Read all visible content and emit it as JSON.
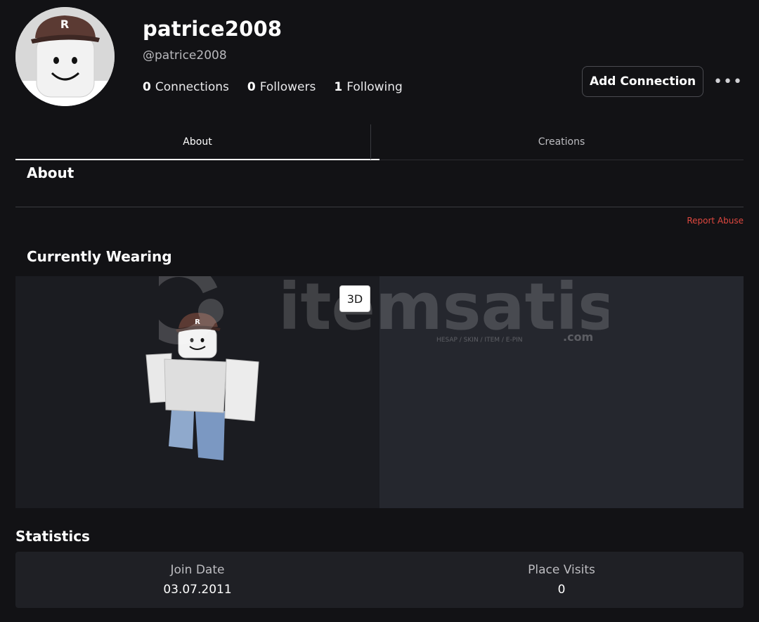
{
  "profile": {
    "display_name": "patrice2008",
    "handle": "@patrice2008",
    "stats": [
      {
        "count": "0",
        "label": "Connections"
      },
      {
        "count": "0",
        "label": "Followers"
      },
      {
        "count": "1",
        "label": "Following"
      }
    ],
    "add_connection_label": "Add Connection",
    "more_label": "•••"
  },
  "tabs": [
    {
      "label": "About",
      "active": true
    },
    {
      "label": "Creations",
      "active": false
    }
  ],
  "about": {
    "title": "About",
    "report_label": "Report Abuse"
  },
  "wearing": {
    "title": "Currently Wearing",
    "toggle_3d_label": "3D",
    "watermark": {
      "brand": "itemsatis",
      "tagline": "HESAP / SKIN / ITEM / E-PIN",
      "suffix": ".com"
    }
  },
  "statistics": {
    "title": "Statistics",
    "items": [
      {
        "label": "Join Date",
        "value": "03.07.2011"
      },
      {
        "label": "Place Visits",
        "value": "0"
      }
    ]
  },
  "colors": {
    "background": "#121215",
    "report_link": "#e0483f",
    "panel_left": "#1b1c21",
    "panel_right": "#25272e",
    "cap": "#5b3a33"
  }
}
